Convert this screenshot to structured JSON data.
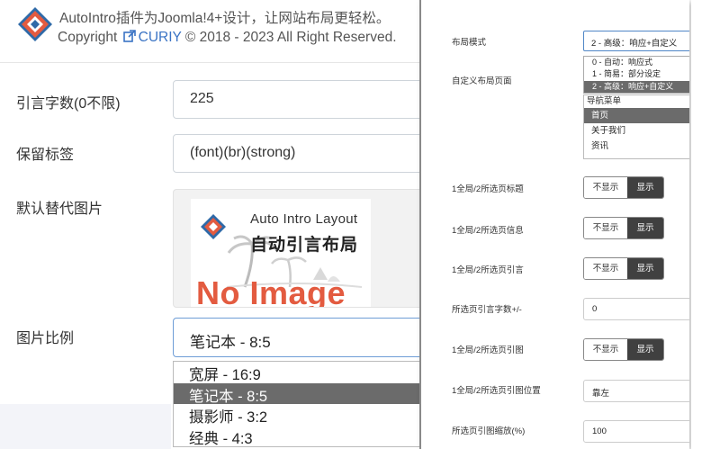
{
  "left": {
    "header": {
      "description": "AutoIntro插件为Joomla!4+设计，让网站布局更轻松。",
      "copyright_prefix": "Copyright",
      "copyright_link": "CURIY",
      "copyright_suffix": "© 2018 - 2023 All Right Reserved."
    },
    "fields": {
      "intro_chars": {
        "label": "引言字数(0不限)",
        "value": "225"
      },
      "keep_tags": {
        "label": "保留标签",
        "value": "(font)(br)(strong)"
      },
      "default_image": {
        "label": "默认替代图片",
        "img_title": "Auto Intro Layout",
        "img_cn": "自动引言布局",
        "img_big": "No Image"
      },
      "image_ratio": {
        "label": "图片比例",
        "selected": "笔记本 - 8:5",
        "options": [
          "宽屏 - 16:9",
          "笔记本 - 8:5",
          "摄影师 - 3:2",
          "经典 - 4:3"
        ],
        "selected_index": 1
      }
    }
  },
  "right": {
    "layout_mode": {
      "label": "布局模式",
      "selected": "2 - 高级：响应+自定义",
      "options": [
        "0 - 自动：响应式",
        "1 - 简易：部分设定",
        "2 - 高级：响应+自定义"
      ],
      "selected_index": 2
    },
    "custom_pages": {
      "label": "自定义布局页面",
      "group": "导航菜单",
      "items": [
        "首页",
        "关于我们",
        "资讯"
      ],
      "selected_index": 0
    },
    "toggles": [
      {
        "label": "1全局/2所选页标题",
        "off": "不显示",
        "on": "显示"
      },
      {
        "label": "1全局/2所选页信息",
        "off": "不显示",
        "on": "显示"
      },
      {
        "label": "1全局/2所选页引言",
        "off": "不显示",
        "on": "显示"
      }
    ],
    "chars_adjust": {
      "label": "所选页引言字数+/-",
      "value": "0"
    },
    "image_toggle": {
      "label": "1全局/2所选页引图",
      "off": "不显示",
      "on": "显示"
    },
    "image_position": {
      "label": "1全局/2所选页引图位置",
      "value": "靠左"
    },
    "image_scale": {
      "label": "所选页引图缩放(%)",
      "value": "100"
    }
  },
  "colors": {
    "accent_blue": "#3a73c4",
    "logo_orange": "#e35b40",
    "selected_gray": "#6b6b6b",
    "toggle_on": "#404040"
  }
}
